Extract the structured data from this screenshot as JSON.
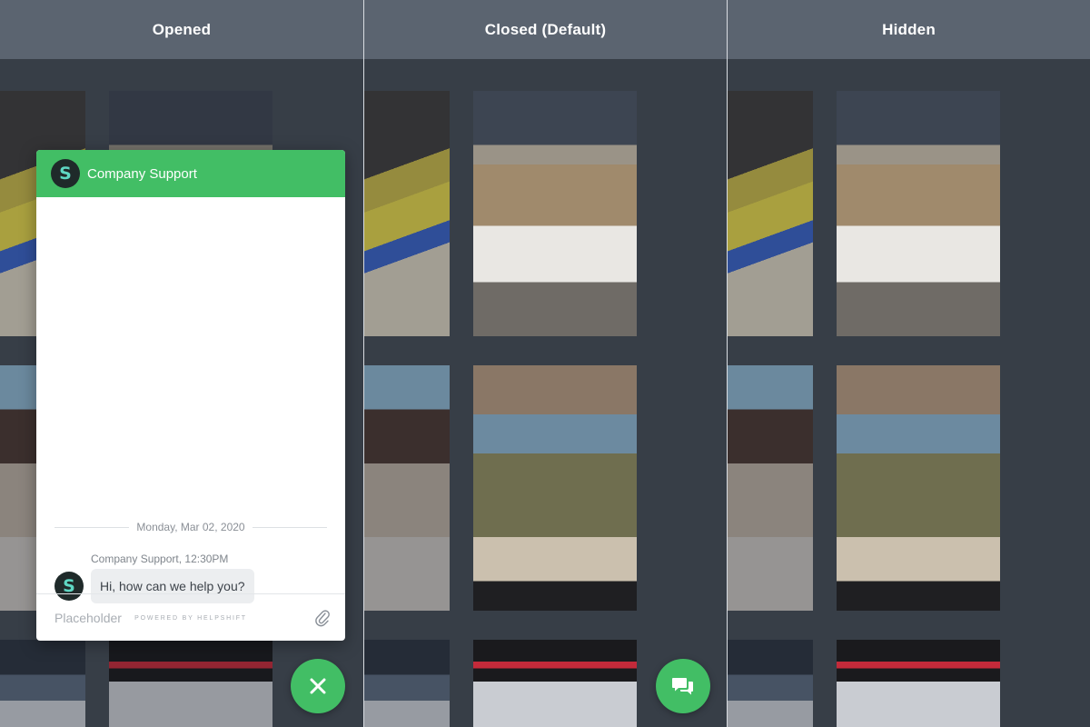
{
  "panels": [
    {
      "title": "Opened"
    },
    {
      "title": "Closed (Default)"
    },
    {
      "title": "Hidden"
    }
  ],
  "chat": {
    "avatar_letter": "S",
    "title": "Company Support",
    "date_divider": "Monday, Mar 02, 2020",
    "sender_line": "Company Support, 12:30PM",
    "message": "Hi, how can we help you?",
    "powered_by": "POWERED BY HELPSHIFT",
    "input_placeholder": "Placeholder"
  },
  "icons": {
    "close_button": "close-icon",
    "chat_button": "chat-bubbles-icon",
    "attach": "paperclip-icon"
  },
  "colors": {
    "accent": "#42be65",
    "header_bg": "#5b6470",
    "page_bg": "#373e47"
  }
}
